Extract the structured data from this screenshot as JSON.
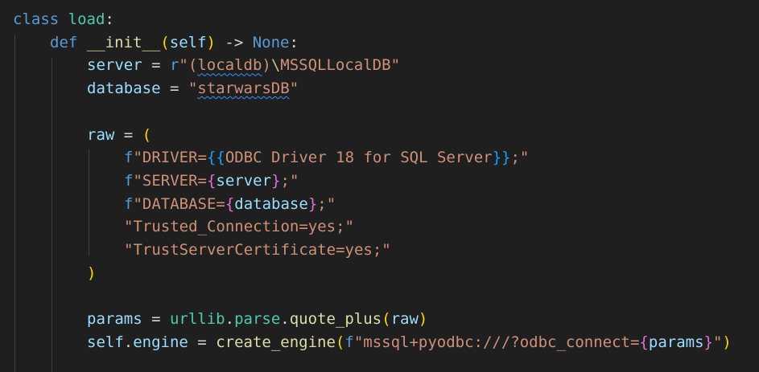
{
  "editor": {
    "language": "python",
    "theme_colors": {
      "background": "#1f1f1f",
      "keyword": "#569cd6",
      "class_name": "#4ec9b0",
      "function": "#dcdcaa",
      "variable": "#9cdcfe",
      "string": "#ce9178",
      "escape": "#d7ba7d",
      "bracket_level_1": "#ffd700",
      "bracket_level_2": "#da70d6",
      "bracket_level_3": "#179fff",
      "spell_squiggle": "#3794ff"
    },
    "lines": [
      {
        "indent": 0,
        "tokens": [
          {
            "t": "class",
            "c": "kw"
          },
          {
            "t": " ",
            "c": "op"
          },
          {
            "t": "load",
            "c": "cls"
          },
          {
            "t": ":",
            "c": "op"
          }
        ]
      },
      {
        "indent": 1,
        "tokens": [
          {
            "t": "def",
            "c": "kw"
          },
          {
            "t": " ",
            "c": "op"
          },
          {
            "t": "__init__",
            "c": "fn"
          },
          {
            "t": "(",
            "c": "p1"
          },
          {
            "t": "self",
            "c": "var"
          },
          {
            "t": ")",
            "c": "p1"
          },
          {
            "t": " -> ",
            "c": "op"
          },
          {
            "t": "None",
            "c": "kw"
          },
          {
            "t": ":",
            "c": "op"
          }
        ]
      },
      {
        "indent": 2,
        "tokens": [
          {
            "t": "server",
            "c": "var"
          },
          {
            "t": " = ",
            "c": "op"
          },
          {
            "t": "r",
            "c": "kw"
          },
          {
            "t": "\"(",
            "c": "str"
          },
          {
            "t": "localdb",
            "c": "str",
            "squiggly": true
          },
          {
            "t": ")",
            "c": "str"
          },
          {
            "t": "\\",
            "c": "esc"
          },
          {
            "t": "MSSQLLocalDB\"",
            "c": "str"
          }
        ]
      },
      {
        "indent": 2,
        "tokens": [
          {
            "t": "database",
            "c": "var"
          },
          {
            "t": " = ",
            "c": "op"
          },
          {
            "t": "\"",
            "c": "str"
          },
          {
            "t": "starwarsDB",
            "c": "str",
            "squiggly": true
          },
          {
            "t": "\"",
            "c": "str"
          }
        ]
      },
      {
        "indent": 0,
        "tokens": []
      },
      {
        "indent": 2,
        "tokens": [
          {
            "t": "raw",
            "c": "var"
          },
          {
            "t": " = ",
            "c": "op"
          },
          {
            "t": "(",
            "c": "p1"
          }
        ]
      },
      {
        "indent": 3,
        "tokens": [
          {
            "t": "f",
            "c": "kw"
          },
          {
            "t": "\"DRIVER=",
            "c": "str"
          },
          {
            "t": "{{",
            "c": "p3"
          },
          {
            "t": "ODBC Driver 18 for SQL Server",
            "c": "str"
          },
          {
            "t": "}}",
            "c": "p3"
          },
          {
            "t": ";\"",
            "c": "str"
          }
        ]
      },
      {
        "indent": 3,
        "tokens": [
          {
            "t": "f",
            "c": "kw"
          },
          {
            "t": "\"SERVER=",
            "c": "str"
          },
          {
            "t": "{",
            "c": "p2"
          },
          {
            "t": "server",
            "c": "var"
          },
          {
            "t": "}",
            "c": "p2"
          },
          {
            "t": ";\"",
            "c": "str"
          }
        ]
      },
      {
        "indent": 3,
        "tokens": [
          {
            "t": "f",
            "c": "kw"
          },
          {
            "t": "\"DATABASE=",
            "c": "str"
          },
          {
            "t": "{",
            "c": "p2"
          },
          {
            "t": "database",
            "c": "var"
          },
          {
            "t": "}",
            "c": "p2"
          },
          {
            "t": ";\"",
            "c": "str"
          }
        ]
      },
      {
        "indent": 3,
        "tokens": [
          {
            "t": "\"Trusted_Connection=yes;\"",
            "c": "str"
          }
        ]
      },
      {
        "indent": 3,
        "tokens": [
          {
            "t": "\"TrustServerCertificate=yes;\"",
            "c": "str"
          }
        ]
      },
      {
        "indent": 2,
        "tokens": [
          {
            "t": ")",
            "c": "p1"
          }
        ]
      },
      {
        "indent": 0,
        "tokens": []
      },
      {
        "indent": 2,
        "tokens": [
          {
            "t": "params",
            "c": "var"
          },
          {
            "t": " = ",
            "c": "op"
          },
          {
            "t": "urllib",
            "c": "cls"
          },
          {
            "t": ".",
            "c": "op"
          },
          {
            "t": "parse",
            "c": "cls"
          },
          {
            "t": ".",
            "c": "op"
          },
          {
            "t": "quote_plus",
            "c": "fn"
          },
          {
            "t": "(",
            "c": "p1"
          },
          {
            "t": "raw",
            "c": "var"
          },
          {
            "t": ")",
            "c": "p1"
          }
        ]
      },
      {
        "indent": 2,
        "tokens": [
          {
            "t": "self",
            "c": "var"
          },
          {
            "t": ".",
            "c": "op"
          },
          {
            "t": "engine",
            "c": "var"
          },
          {
            "t": " = ",
            "c": "op"
          },
          {
            "t": "create_engine",
            "c": "fn"
          },
          {
            "t": "(",
            "c": "p1"
          },
          {
            "t": "f",
            "c": "kw"
          },
          {
            "t": "\"mssql+pyodbc:///?odbc_connect=",
            "c": "str"
          },
          {
            "t": "{",
            "c": "p2"
          },
          {
            "t": "params",
            "c": "var"
          },
          {
            "t": "}",
            "c": "p2"
          },
          {
            "t": "\"",
            "c": "str"
          },
          {
            "t": ")",
            "c": "p1"
          }
        ]
      },
      {
        "indent": 0,
        "tokens": []
      }
    ]
  }
}
